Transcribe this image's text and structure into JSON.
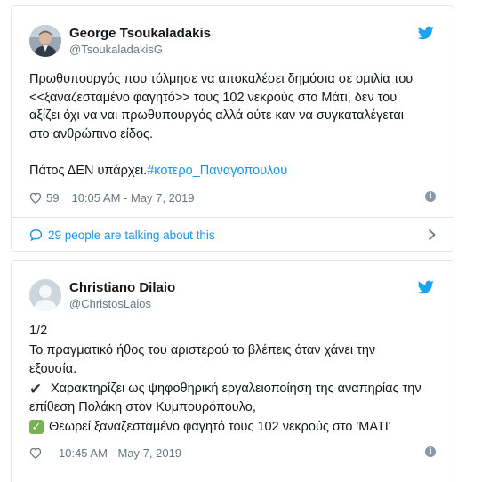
{
  "tweets": [
    {
      "display_name": "George Tsoukaladakis",
      "handle": "@TsoukaladakisG",
      "lines": [
        "Πρωθυπουργός που τόλμησε να αποκαλέσει δημόσια σε ομιλία του",
        "<<ξαναζεσταμένο φαγητό>> τους 102 νεκρούς στο Μάτι, δεν του",
        "αξίζει όχι να ναι πρωθυπουργός αλλά ούτε καν να συγκαταλέγεται",
        "στο ανθρώπινο είδος."
      ],
      "last_line": "Πάτος ΔΕΝ υπάρχει.",
      "hashtag": "#κοτερο_Παναγοπουλου",
      "likes": "59",
      "timestamp": "10:05 AM - May 7, 2019",
      "talking": "29 people are talking about this",
      "icons": {
        "avatar": "avatar",
        "bird": "twitter-bird-icon",
        "heart": "heart-icon",
        "info": "info-icon",
        "bubble": "speech-bubble-icon",
        "chevron": "chevron-right-icon"
      }
    },
    {
      "display_name": "Christiano Dilaio",
      "handle": "@ChristosLaios",
      "lines": [
        "1/2",
        "Το πραγματικό ήθος του αριστερού το βλέπεις όταν χάνει την",
        "εξουσία."
      ],
      "check1": "Χαρακτηρίζει ως ψηφοθηρική εργαλειοποίηση της αναπηρίας την",
      "check1_cont": "επίθεση Πολάκη στον Κυμπουρόπουλο,",
      "check2": "Θεωρεί ξαναζεσταμένο φαγητό τους 102 νεκρούς στο 'ΜΑΤΙ'",
      "likes": "",
      "timestamp": "10:45 AM - May 7, 2019",
      "icons": {
        "avatar": "default-avatar",
        "bird": "twitter-bird-icon",
        "heart": "heart-icon",
        "info": "info-icon",
        "check1": "heavy-check-mark-icon",
        "check2": "white-check-mark-icon"
      }
    }
  ],
  "colors": {
    "link": "#1b95e0",
    "muted": "#657786",
    "border": "#e1e8ed",
    "twitter_blue": "#1da1f2"
  }
}
